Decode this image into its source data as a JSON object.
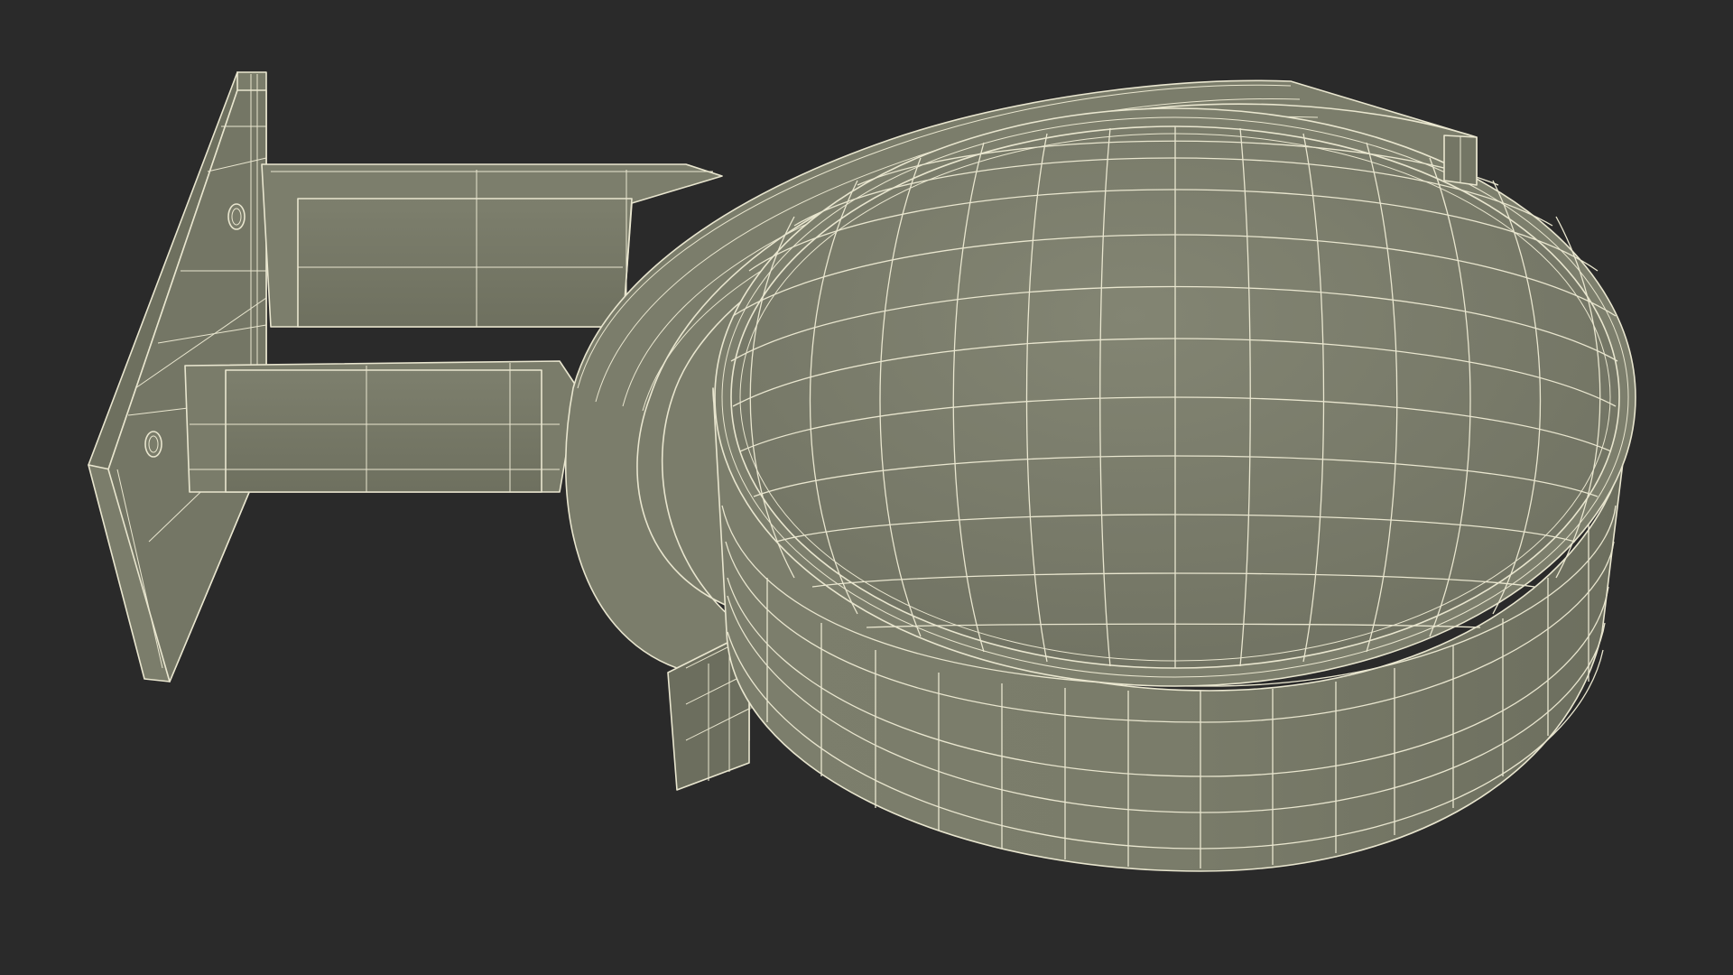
{
  "scene": {
    "background_color": "#2a2a2a",
    "mesh_face_color": "#787a68",
    "mesh_face_shadow": "#6a6c5c",
    "mesh_face_highlight": "#848674",
    "wireframe_color": "#e9e6cf",
    "render_style": "wireframe-over-shaded",
    "parts": {
      "wall_plate": "wall-mount-plate",
      "upper_arm": "upper-support-arm",
      "lower_arm": "lower-support-arm",
      "ring_bracket": "ring-bracket",
      "cap_top": "dome-cap-top",
      "cap_side": "cap-cylinder-side",
      "bolts": [
        "bolt-upper",
        "bolt-lower"
      ]
    }
  }
}
